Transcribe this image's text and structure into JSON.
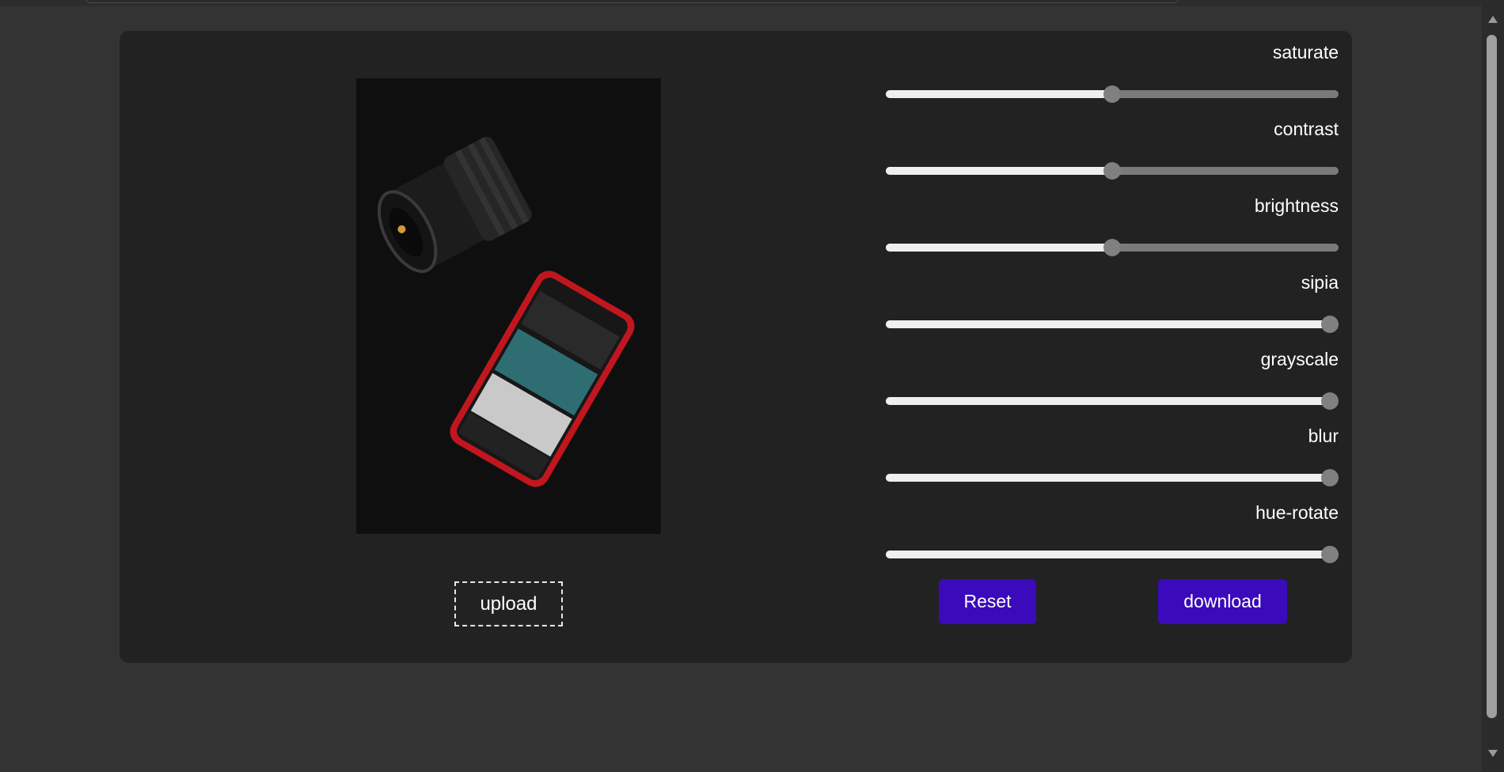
{
  "editor": {
    "upload_label": "upload",
    "reset_label": "Reset",
    "download_label": "download",
    "photo_icon": "camera-and-phone-photo",
    "accent_color": "#3b0aba"
  },
  "filters": [
    {
      "label": "saturate",
      "value": 0.5
    },
    {
      "label": "contrast",
      "value": 0.5
    },
    {
      "label": "brightness",
      "value": 0.5
    },
    {
      "label": "sipia",
      "value": 1.0
    },
    {
      "label": "grayscale",
      "value": 1.0
    },
    {
      "label": "blur",
      "value": 1.0
    },
    {
      "label": "hue-rotate",
      "value": 1.0
    }
  ]
}
